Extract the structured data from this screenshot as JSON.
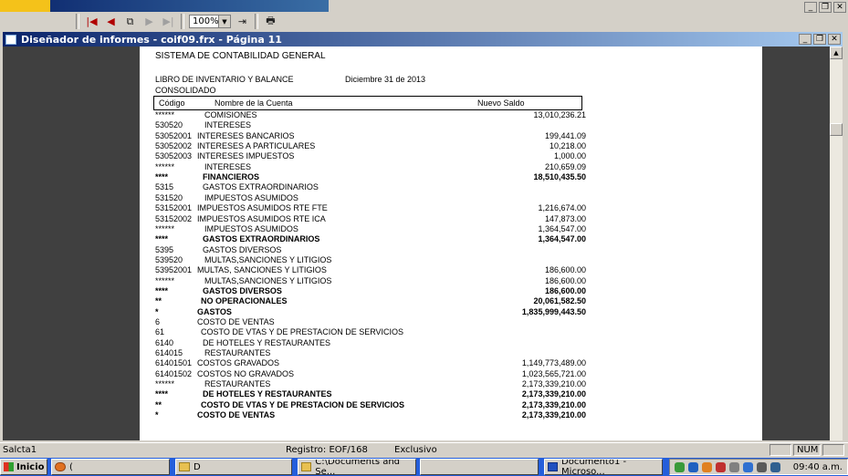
{
  "toolbar": {
    "first": "|◀",
    "prev": "◀",
    "goto": "⧉",
    "next": "▶",
    "last": "▶|",
    "zoom": "100%",
    "exit": "⇥",
    "print": "🖶"
  },
  "window_controls": {
    "minimize": "_",
    "restore": "❐",
    "close": "✕"
  },
  "inner_window": {
    "title": "Diseñador de informes - coif09.frx - Página 11"
  },
  "report": {
    "system_title": "SISTEMA DE CONTABILIDAD GENERAL",
    "book_title": "LIBRO DE INVENTARIO Y BALANCE",
    "date": "Diciembre 31 de 2013",
    "consolidated": "CONSOLIDADO",
    "col_code": "Código",
    "col_name": "Nombre de la Cuenta",
    "col_balance": "Nuevo Saldo",
    "rows": [
      {
        "code": "******",
        "name": "COMISIONES",
        "value": "13,010,236.21",
        "bold": false,
        "indent": 54
      },
      {
        "code": "530520",
        "name": "INTERESES",
        "value": "",
        "bold": false,
        "indent": 54
      },
      {
        "code": "53052001",
        "name": "INTERESES BANCARIOS",
        "value": "199,441.09",
        "bold": false,
        "indent": 46
      },
      {
        "code": "53052002",
        "name": "INTERESES A PARTICULARES",
        "value": "10,218.00",
        "bold": false,
        "indent": 46
      },
      {
        "code": "53052003",
        "name": "INTERESES IMPUESTOS",
        "value": "1,000.00",
        "bold": false,
        "indent": 46
      },
      {
        "code": "******",
        "name": "INTERESES",
        "value": "210,659.09",
        "bold": false,
        "indent": 54
      },
      {
        "code": "****",
        "name": "FINANCIEROS",
        "value": "18,510,435.50",
        "bold": true,
        "indent": 52
      },
      {
        "code": "5315",
        "name": "GASTOS EXTRAORDINARIOS",
        "value": "",
        "bold": false,
        "indent": 52
      },
      {
        "code": "531520",
        "name": "IMPUESTOS ASUMIDOS",
        "value": "",
        "bold": false,
        "indent": 54
      },
      {
        "code": "53152001",
        "name": "IMPUESTOS ASUMIDOS RTE FTE",
        "value": "1,216,674.00",
        "bold": false,
        "indent": 46
      },
      {
        "code": "53152002",
        "name": "IMPUESTOS ASUMIDOS RTE ICA",
        "value": "147,873.00",
        "bold": false,
        "indent": 46
      },
      {
        "code": "******",
        "name": "IMPUESTOS ASUMIDOS",
        "value": "1,364,547.00",
        "bold": false,
        "indent": 54
      },
      {
        "code": "****",
        "name": "GASTOS EXTRAORDINARIOS",
        "value": "1,364,547.00",
        "bold": true,
        "indent": 52
      },
      {
        "code": "5395",
        "name": "GASTOS DIVERSOS",
        "value": "",
        "bold": false,
        "indent": 52
      },
      {
        "code": "539520",
        "name": "MULTAS,SANCIONES Y LITIGIOS",
        "value": "",
        "bold": false,
        "indent": 54
      },
      {
        "code": "53952001",
        "name": "MULTAS, SANCIONES Y LITIGIOS",
        "value": "186,600.00",
        "bold": false,
        "indent": 46
      },
      {
        "code": "******",
        "name": "MULTAS,SANCIONES Y LITIGIOS",
        "value": "186,600.00",
        "bold": false,
        "indent": 54
      },
      {
        "code": "****",
        "name": "GASTOS DIVERSOS",
        "value": "186,600.00",
        "bold": true,
        "indent": 52
      },
      {
        "code": "**",
        "name": "NO OPERACIONALES",
        "value": "20,061,582.50",
        "bold": true,
        "indent": 50
      },
      {
        "code": "*",
        "name": "GASTOS",
        "value": "1,835,999,443.50",
        "bold": true,
        "indent": 46
      },
      {
        "code": "6",
        "name": "COSTO DE VENTAS",
        "value": "",
        "bold": false,
        "indent": 46
      },
      {
        "code": "61",
        "name": "COSTO DE VTAS Y DE PRESTACION DE SERVICIOS",
        "value": "",
        "bold": false,
        "indent": 50
      },
      {
        "code": "6140",
        "name": "DE HOTELES Y RESTAURANTES",
        "value": "",
        "bold": false,
        "indent": 52
      },
      {
        "code": "614015",
        "name": "RESTAURANTES",
        "value": "",
        "bold": false,
        "indent": 54
      },
      {
        "code": "61401501",
        "name": "COSTOS GRAVADOS",
        "value": "1,149,773,489.00",
        "bold": false,
        "indent": 46
      },
      {
        "code": "61401502",
        "name": "COSTOS NO GRAVADOS",
        "value": "1,023,565,721.00",
        "bold": false,
        "indent": 46
      },
      {
        "code": "******",
        "name": "RESTAURANTES",
        "value": "2,173,339,210.00",
        "bold": false,
        "indent": 54
      },
      {
        "code": "****",
        "name": "DE HOTELES Y RESTAURANTES",
        "value": "2,173,339,210.00",
        "bold": true,
        "indent": 52
      },
      {
        "code": "**",
        "name": "COSTO DE VTAS Y DE PRESTACION DE SERVICIOS",
        "value": "2,173,339,210.00",
        "bold": true,
        "indent": 50
      },
      {
        "code": "*",
        "name": "COSTO DE VENTAS",
        "value": "2,173,339,210.00",
        "bold": true,
        "indent": 46
      }
    ]
  },
  "statusbar": {
    "left": "Salcta1",
    "record": "Registro: EOF/168",
    "mode": "Exclusivo",
    "num": "NUM"
  },
  "taskbar": {
    "start": "Inicio",
    "tasks": [
      "(",
      "D",
      "C:\\Documents and Se...",
      "",
      "Documento1 - Microso..."
    ],
    "clock": "09:40 a.m."
  }
}
